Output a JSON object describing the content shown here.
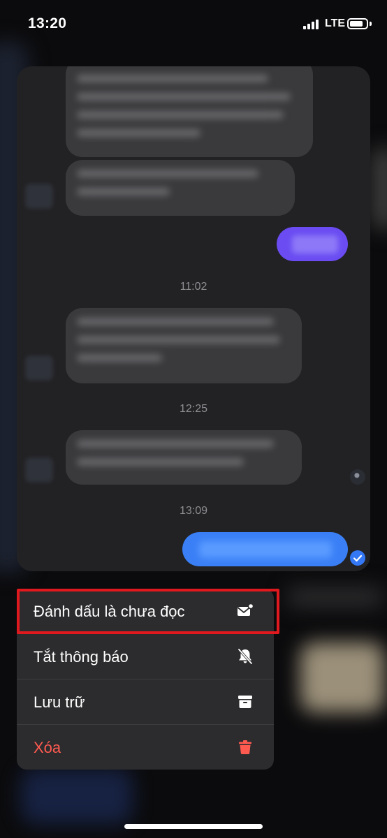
{
  "status_bar": {
    "time": "13:20",
    "network": "LTE",
    "battery_level": 0.8
  },
  "conversation": {
    "timestamps": [
      "11:02",
      "12:25",
      "13:09"
    ]
  },
  "context_menu": {
    "items": [
      {
        "label": "Đánh dấu là chưa đọc",
        "icon": "mark-unread-envelope-icon"
      },
      {
        "label": "Tắt thông báo",
        "icon": "bell-slash-icon"
      },
      {
        "label": "Lưu trữ",
        "icon": "archive-box-icon"
      },
      {
        "label": "Xóa",
        "icon": "trash-icon",
        "color": "#ff5a50"
      }
    ]
  },
  "colors": {
    "highlight": "#e0191f",
    "sent_bubble_blue": "#3a7ff6",
    "sent_bubble_purple": "#6a4cf2",
    "danger": "#ff5a50"
  }
}
